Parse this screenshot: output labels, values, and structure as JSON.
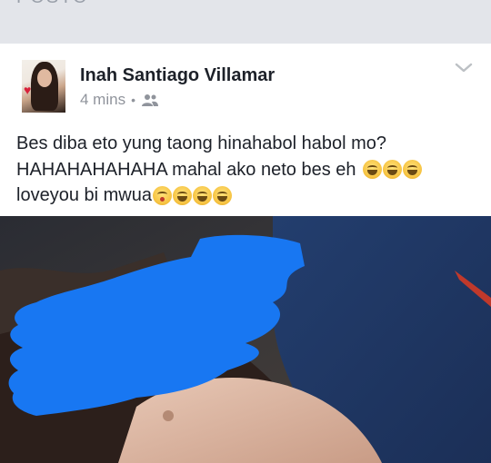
{
  "top_strip": {
    "cut_text": "POSTO"
  },
  "post": {
    "author": "Inah Santiago Villamar",
    "time": "4 mins",
    "separator": "•",
    "audience_icon": "friends-icon",
    "menu_icon": "chevron-down-icon",
    "message_lines": [
      "Bes diba eto yung taong hinahabol habol mo?",
      "HAHAHAHAHAHA mahal ako neto bes eh",
      "loveyou bi mwua"
    ],
    "emoji": {
      "line2": [
        "laughing-tears-emoji",
        "laughing-tears-emoji",
        "laughing-tears-emoji"
      ],
      "line3": [
        "kissing-emoji",
        "laughing-tears-emoji",
        "laughing-tears-emoji",
        "laughing-tears-emoji"
      ]
    },
    "photo": {
      "description_icon": "photo-image",
      "redaction_color": "#1877f2"
    }
  }
}
